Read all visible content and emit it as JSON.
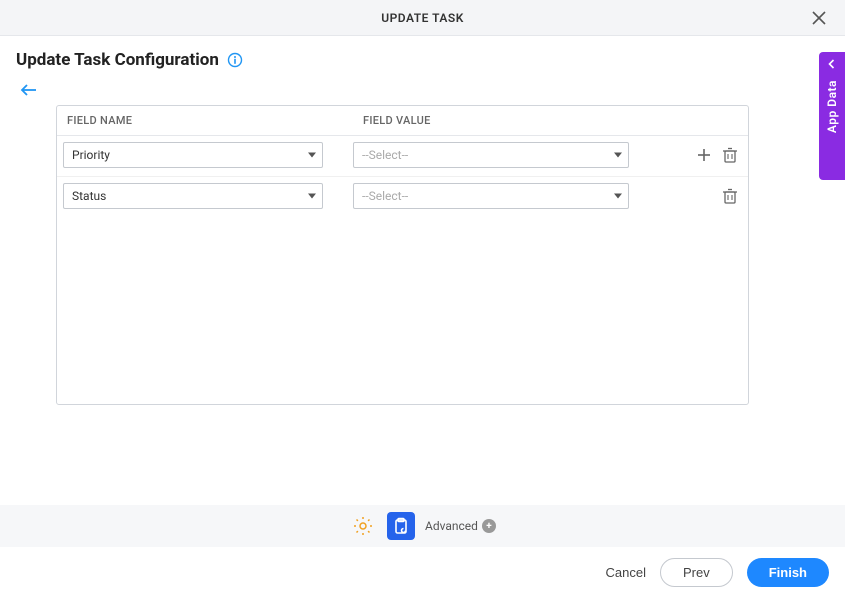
{
  "header": {
    "title": "UPDATE TASK"
  },
  "page": {
    "title": "Update Task Configuration"
  },
  "table": {
    "columns": {
      "name": "FIELD NAME",
      "value": "FIELD VALUE"
    },
    "rows": [
      {
        "name": "Priority",
        "value_placeholder": "--Select--"
      },
      {
        "name": "Status",
        "value_placeholder": "--Select--"
      }
    ]
  },
  "toolbar": {
    "advanced": "Advanced"
  },
  "buttons": {
    "cancel": "Cancel",
    "prev": "Prev",
    "finish": "Finish"
  },
  "side_tab": {
    "label": "App Data"
  }
}
